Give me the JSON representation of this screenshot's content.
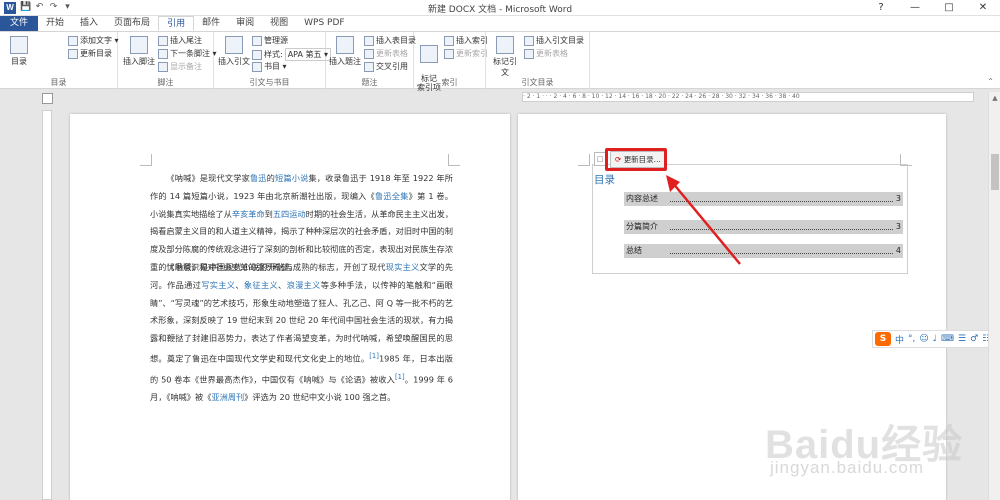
{
  "window": {
    "title": "新建 DOCX 文档 - Microsoft Word",
    "app_icon": "W",
    "qat": [
      "save-icon",
      "undo-icon",
      "redo-icon",
      "customize-icon"
    ],
    "controls": [
      "?",
      "—",
      "□",
      "✕"
    ]
  },
  "tabs": [
    "文件",
    "开始",
    "插入",
    "页面布局",
    "引用",
    "邮件",
    "审阅",
    "视图",
    "WPS PDF"
  ],
  "active_tab": "引用",
  "ribbon": {
    "toc": {
      "big": "目录",
      "add_text": "添加文字 ▾",
      "update": "更新目录",
      "label": "目录"
    },
    "footnotes": {
      "insert_footnote": "插入脚注",
      "insert_endnote": "插入尾注",
      "next_footnote": "下一条脚注 ▾",
      "show_notes": "显示备注",
      "label": "脚注"
    },
    "citations": {
      "insert_citation": "插入引文",
      "manage_sources": "管理源",
      "style_label": "样式:",
      "style_value": "APA 第五 ▾",
      "bibliography": "书目 ▾",
      "label": "引文与书目"
    },
    "captions": {
      "insert_caption": "插入题注",
      "insert_table_of_figures": "插入表目录",
      "update_table": "更新表格",
      "cross_reference": "交叉引用",
      "label": "题注"
    },
    "index": {
      "mark_entry": "标记\n索引项",
      "insert_index": "插入索引",
      "update_index": "更新索引",
      "label": "索引"
    },
    "authorities": {
      "mark_citation": "标记引文",
      "insert_table": "插入引文目录",
      "update_table": "更新表格",
      "label": "引文目录"
    }
  },
  "ruler_text": "· 2 · 1 · · · 2 · 4 · 6 · 8 · 10 · 12 · 14 · 16 · 18 · 20 · 22 · 24 · 26 · 28 · 30 · 32 · 34 · 36 · 38 · 40",
  "document": {
    "para1": {
      "s1": "《呐喊》是现代文学家",
      "l1": "鲁迅",
      "s2": "的",
      "l2": "短篇小说",
      "s3": "集，收录鲁迅于 1918 年至 1922 年所作的 14 篇短篇小说，1923 年由北京新潮社出版，现编入《",
      "l3": "鲁迅全集",
      "s4": "》第 1 卷。小说集真实地描绘了从",
      "l4": "辛亥革命",
      "s5": "到",
      "l5": "五四运动",
      "s6": "时期的社会生活，从革命民主主义出发，揭看启蒙主义目的和人道主义精神，揭示了种种深层次的社会矛盾，对旧时中国的制度及部分陈腐的传统观念进行了深刻的剖析和比较彻底的否定，表现出对民族生存浓重的忧患意识和对社会变革的强烈希望。"
    },
    "para2": {
      "s1": "《呐喊》是中国现代小说的开端与成熟的标志，开创了现代",
      "l1": "现实主义",
      "s2": "文学的先河。作品通过",
      "l2": "写实主义",
      "s3": "、",
      "l3": "象征主义",
      "s4": "、",
      "l4": "浪漫主义",
      "s5": "等多种手法，以传神的笔触和“画眼睛”、“写灵魂”的艺术技巧，形象生动地塑造了狂人、孔乙己、阿 Q 等一批不朽的艺术形象，深刻反映了 19 世纪末到 20 世纪 20 年代间中国社会生活的现状，有力揭露和鞭挞了封建旧恶势力，表达了作者渴望变革，为时代呐喊，希望唤醒国民的思想。奠定了鲁迅在中国现代文学史和现代文化史上的地位。",
      "l5": "[1]",
      "s6": "1985 年，日本出版的 50 卷本《世界最高杰作》，中国仅有《呐喊》与《论语》被收入",
      "l6": "[1]",
      "s7": "。1999 年 6 月，《呐喊》被《",
      "l7": "亚洲周刊",
      "s8": "》评选为 20 世纪中文小说 100 强之首。"
    }
  },
  "toc": {
    "update_button": "更新目录...",
    "title": "目录",
    "entries": [
      {
        "text": "内容总述",
        "page": "3"
      },
      {
        "text": "分篇简介",
        "page": "3"
      },
      {
        "text": "总结",
        "page": "4"
      }
    ]
  },
  "ime_toolbar": {
    "logo": "S",
    "lang": "中",
    "items": [
      "°,",
      "☺",
      "♩",
      "⌨",
      "☰",
      "♂",
      "☷"
    ]
  },
  "watermark": {
    "main": "Baidu经验",
    "sub": "jingyan.baidu.com"
  },
  "colors": {
    "word_blue": "#2b579a",
    "link_blue": "#2e75b6",
    "annotation_red": "#e02020",
    "toc_heading": "#2e74b5"
  }
}
